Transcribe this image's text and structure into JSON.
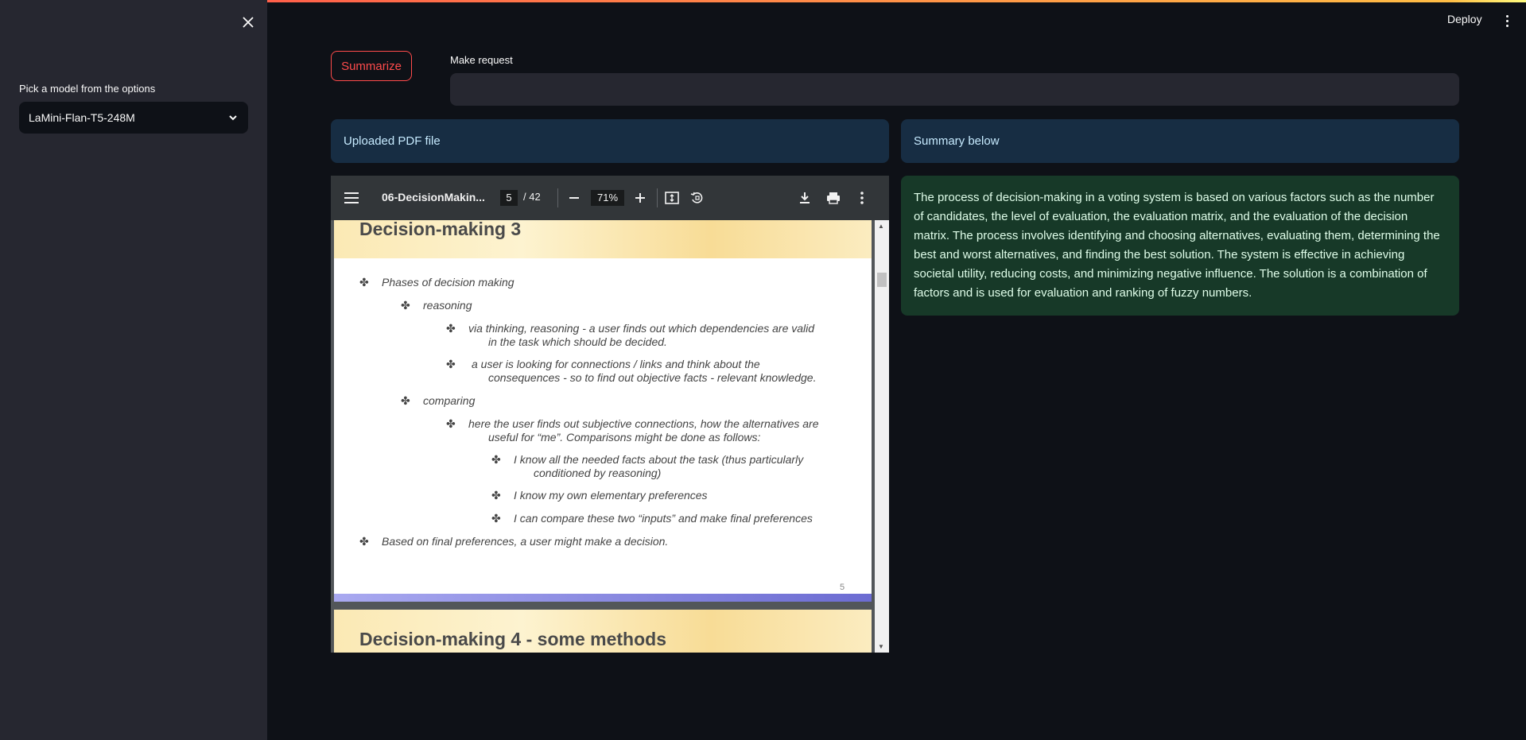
{
  "sidebar": {
    "close_icon": "close-icon",
    "model_label": "Pick a model from the options",
    "model_selected": "LaMini-Flan-T5-248M"
  },
  "header": {
    "deploy_label": "Deploy"
  },
  "main": {
    "summarize_label": "Summarize",
    "request_label": "Make request",
    "request_value": "",
    "uploaded_info": "Uploaded PDF file",
    "summary_info": "Summary below",
    "summary_text": "The process of decision-making in a voting system is based on various factors such as the number of candidates, the level of evaluation, the evaluation matrix, and the evaluation of the decision matrix. The process involves identifying and choosing alternatives, evaluating them, determining the best and worst alternatives, and finding the best solution. The system is effective in achieving societal utility, reducing costs, and minimizing negative influence. The solution is a combination of factors and is used for evaluation and ranking of fuzzy numbers."
  },
  "pdf_viewer": {
    "file_title": "06-DecisionMakin...",
    "current_page": "5",
    "total_pages": "/ 42",
    "zoom": "71%",
    "page1": {
      "heading": "Decision-making 3",
      "bullets": [
        "Phases of decision making",
        "reasoning",
        "via thinking, reasoning - a user finds out which dependencies are valid",
        "in the task which should be decided.",
        "a user is looking for connections / links and think about the",
        "consequences - so to find out objective facts - relevant knowledge.",
        "comparing",
        "here the user finds out subjective connections, how the alternatives are",
        "useful for “me”. Comparisons might be done as follows:",
        "I know all the needed facts about the task (thus particularly",
        "conditioned by reasoning)",
        "I know my own elementary preferences",
        "I can compare these two “inputs” and make final preferences",
        "Based on final preferences, a user might make a decision."
      ],
      "page_number": "5"
    },
    "page2": {
      "heading": "Decision-making 4 - some methods"
    }
  }
}
